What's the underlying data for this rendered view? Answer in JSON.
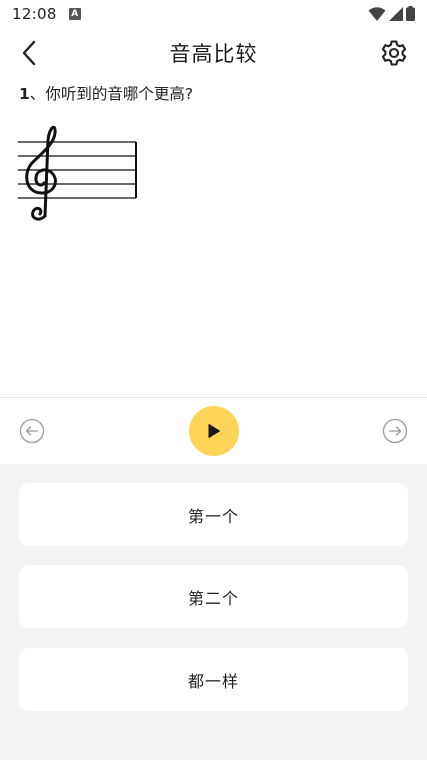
{
  "status_bar": {
    "time": "12:08",
    "notification_letter": "A"
  },
  "header": {
    "title": "音高比较"
  },
  "question": {
    "number": "1",
    "separator": "、",
    "text": "你听到的音哪个更高?"
  },
  "staff": {
    "clef": "treble",
    "lines": 5
  },
  "controls": {
    "prev_icon": "arrow-left-circle-icon",
    "play_icon": "play-icon",
    "next_icon": "arrow-right-circle-icon",
    "play_color": "#fdd458"
  },
  "options": [
    {
      "label": "第一个"
    },
    {
      "label": "第二个"
    },
    {
      "label": "都一样"
    }
  ]
}
